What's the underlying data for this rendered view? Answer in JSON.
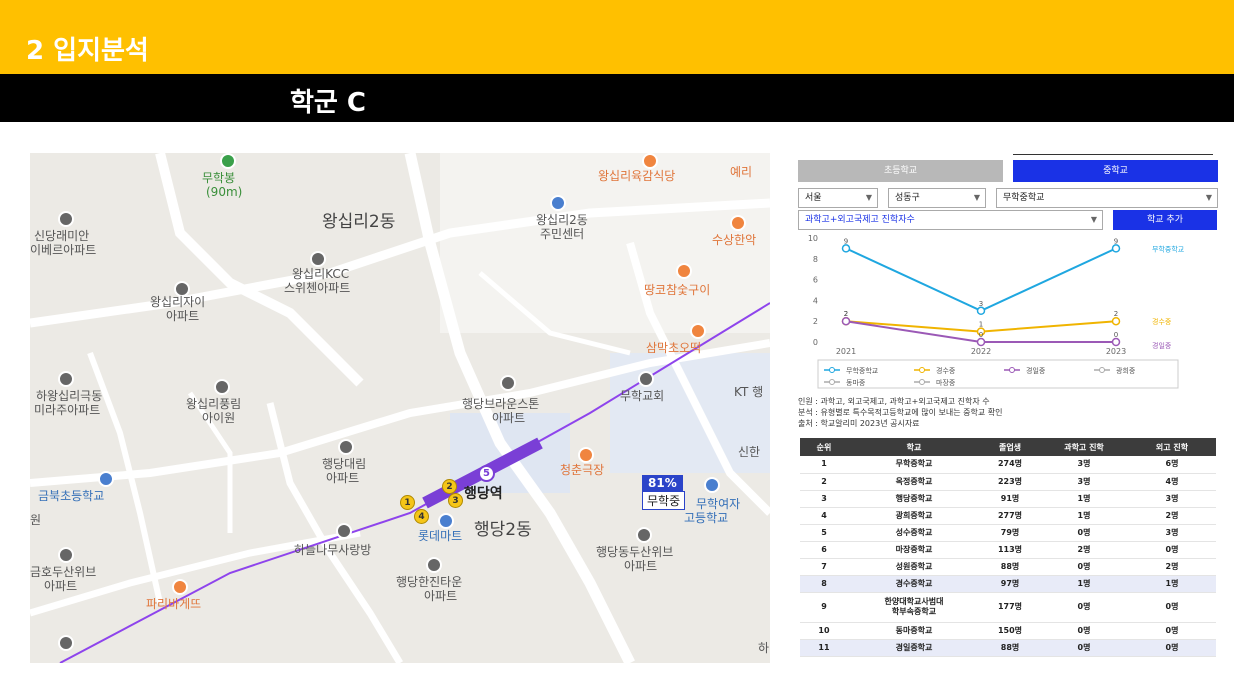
{
  "header": {
    "title": "2 입지분석"
  },
  "subheader": {
    "title": "학군 C"
  },
  "map": {
    "labels": {
      "muhakbong": "무학봉",
      "muhakbong_dist": "(90m)",
      "wangsimni2dong": "왕십리2동",
      "wangsimni2dong_center_1": "왕십리2동",
      "wangsimni2dong_center_2": "주민센터",
      "wangsimni_yukgam": "왕십리육감식당",
      "yeri": "예리",
      "sinsangrae_1": "신당래미안",
      "sinsangrae_2": "이베르아파트",
      "kcc_1": "왕십리KCC",
      "kcc_2": "스위첸아파트",
      "susang": "수상한악",
      "ttangkko": "땅코참숯구이",
      "zai_1": "왕십리자이",
      "zai_2": "아파트",
      "sammak": "삼막초오떡",
      "hawang_1": "하왕십리극동",
      "hawang_2": "미라주아파트",
      "pungrim_1": "왕십리풍림",
      "pungrim_2": "아이원",
      "brown_1": "행당브라운스톤",
      "brown_2": "아파트",
      "muhak_church": "무학교회",
      "kt": "KT 행",
      "daerim_1": "행당대림",
      "daerim_2": "아파트",
      "cheongchun": "청춘극장",
      "sinhan": "신한",
      "geumbuk": "금북초등학교",
      "won": "원",
      "haengdang_station": "행당역",
      "muhak_girls_1": "무학여자",
      "muhak_girls_2": "고등학교",
      "lotte": "롯데마트",
      "haengdang2dong": "행당2동",
      "haneul": "하늘나무사랑방",
      "doosan_1": "행당동두산위브",
      "doosan_2": "아파트",
      "geumho_1": "금호두산위브",
      "geumho_2": "아파트",
      "hanjin_1": "행당한진타운",
      "hanjin_2": "아파트",
      "paris": "파리바게뜨",
      "ha": "하"
    },
    "exits": [
      "1",
      "2",
      "3",
      "4"
    ],
    "line_exit": "5",
    "flag_percent": "81%",
    "flag_school": "무학중"
  },
  "panel": {
    "tab_elementary": "초등학교",
    "tab_middle": "중학교",
    "select_city": "서울",
    "select_district": "성동구",
    "select_school": "무학중학교",
    "select_metric": "과학고+외고국제고 진학자수",
    "add_school_button": "학교 추가"
  },
  "chart_data": {
    "type": "line",
    "x": [
      "2021",
      "2022",
      "2023"
    ],
    "ylim": [
      0,
      10
    ],
    "yticks": [
      "10",
      "8",
      "6",
      "4",
      "2",
      "0"
    ],
    "series": [
      {
        "name": "무학중학교",
        "values": [
          9,
          3,
          9
        ],
        "color": "#1fa7e0"
      },
      {
        "name": "경수중",
        "values": [
          2,
          1,
          2
        ],
        "color": "#f0b400"
      },
      {
        "name": "경일중",
        "values": [
          2,
          0,
          0
        ],
        "color": "#9b59b6"
      }
    ],
    "legend": [
      "무학중학교",
      "경수중",
      "경일중",
      "광희중",
      "동마중",
      "마장중"
    ],
    "legend_colors": [
      "#1fa7e0",
      "#f0b400",
      "#9b59b6",
      "#aaaaaa",
      "#aaaaaa",
      "#aaaaaa"
    ]
  },
  "notes": {
    "line1": "인원 : 과학고, 외고국제고, 과학고+외고국제고 진학자 수",
    "line2": "분석 : 유형별로 특수목적고등학교에 많이 보내는 중학교 확인",
    "line3": "출처 : 학교알리미 2023년 공시자료"
  },
  "table": {
    "headers": [
      "순위",
      "학교",
      "졸업생",
      "과학고 진학",
      "외고 진학"
    ],
    "rows": [
      [
        "1",
        "무학중학교",
        "274명",
        "3명",
        "6명"
      ],
      [
        "2",
        "옥정중학교",
        "223명",
        "3명",
        "4명"
      ],
      [
        "3",
        "행당중학교",
        "91명",
        "1명",
        "3명"
      ],
      [
        "4",
        "광희중학교",
        "277명",
        "1명",
        "2명"
      ],
      [
        "5",
        "성수중학교",
        "79명",
        "0명",
        "3명"
      ],
      [
        "6",
        "마장중학교",
        "113명",
        "2명",
        "0명"
      ],
      [
        "7",
        "성원중학교",
        "88명",
        "0명",
        "2명"
      ],
      [
        "8",
        "경수중학교",
        "97명",
        "1명",
        "1명"
      ],
      [
        "9",
        "한양대학교사범대\n학부속중학교",
        "177명",
        "0명",
        "0명"
      ],
      [
        "10",
        "동마중학교",
        "150명",
        "0명",
        "0명"
      ],
      [
        "11",
        "경일중학교",
        "88명",
        "0명",
        "0명"
      ]
    ]
  }
}
